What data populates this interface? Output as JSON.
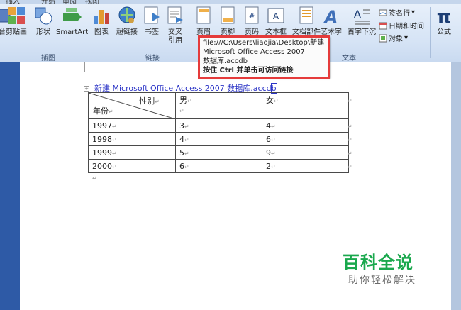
{
  "ribbon": {
    "menu": [
      "插入",
      "开始",
      "审阅",
      "视图"
    ],
    "buttons": {
      "clip_partial": "台",
      "clipart": "剪贴画",
      "shapes": "形状",
      "smartart": "SmartArt",
      "chart": "图表",
      "hyperlink": "超链接",
      "bookmark": "书签",
      "crossref_line1": "交叉",
      "crossref_line2": "引用",
      "header": "页眉",
      "footer": "页脚",
      "page_number": "页码",
      "textbox": "文本框",
      "quickparts": "文档部件",
      "wordart": "艺术字",
      "dropcap": "首字下沉",
      "equation": "公式"
    },
    "small_items": {
      "signature": "签名行",
      "datetime": "日期和时间",
      "object": "对象"
    },
    "groups": {
      "illustrations": "插图",
      "links": "链接",
      "text": "文本"
    }
  },
  "tooltip": {
    "line1": "file:///C:\\Users\\liaojia\\Desktop\\新建",
    "line2": "Microsoft Office Access 2007",
    "line3": "数据库.accdb",
    "hint": "按住 Ctrl 并单击可访问链接"
  },
  "document": {
    "link_text_a": "新建  Microsoft Office Access 2007  数据库.accd",
    "link_text_b": "b",
    "table": {
      "header_gender": "性别",
      "header_year": "年份",
      "col_male": "男",
      "col_female": "女",
      "rows": [
        {
          "year": "1997",
          "male": "3",
          "female": "4"
        },
        {
          "year": "1998",
          "male": "4",
          "female": "6"
        },
        {
          "year": "1999",
          "male": "5",
          "female": "9"
        },
        {
          "year": "2000",
          "male": "6",
          "female": "2"
        }
      ]
    },
    "para_mark": "↵"
  },
  "watermark": {
    "title": "百科全说",
    "subtitle": "助你轻松解决"
  }
}
